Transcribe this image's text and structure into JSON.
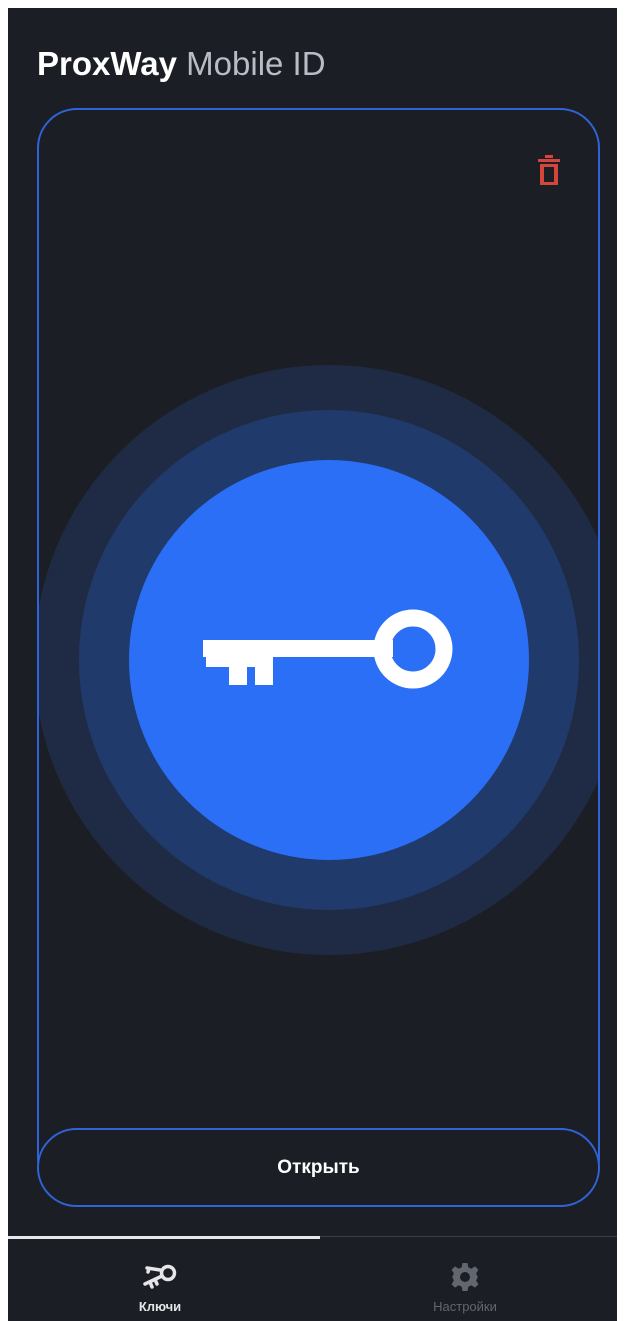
{
  "header": {
    "brand": "ProxWay",
    "subtitle": "Mobile ID"
  },
  "key_card": {
    "delete_icon": "trash-icon",
    "key_icon": "key-icon",
    "open_label": "Открыть"
  },
  "nav": {
    "tabs": [
      {
        "label": "Ключи",
        "icon": "keys-icon",
        "active": true
      },
      {
        "label": "Настройки",
        "icon": "gear-icon",
        "active": false
      }
    ]
  },
  "colors": {
    "background": "#1b1e25",
    "accent": "#2b6ff6",
    "card_border": "#2f64d8",
    "delete": "#d4453b",
    "inactive": "#62666f"
  }
}
